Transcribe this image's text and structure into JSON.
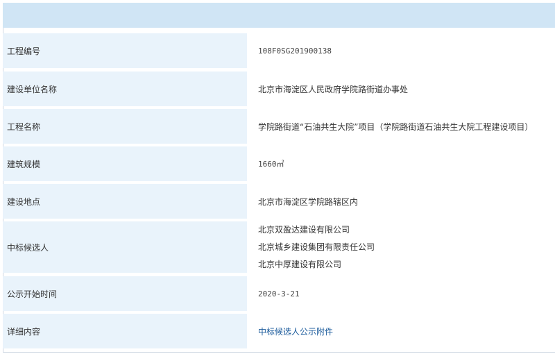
{
  "colors": {
    "header": "#d0e5f5",
    "label_bg": "#e9f3fb",
    "link": "#1a5a9b"
  },
  "rows": {
    "project_number": {
      "label": "工程编号",
      "value": "108F0SG201900138"
    },
    "builder": {
      "label": "建设单位名称",
      "value": "北京市海淀区人民政府学院路街道办事处"
    },
    "project_name": {
      "label": "工程名称",
      "value": "学院路街道“石油共生大院”项目（学院路街道石油共生大院工程建设项目）"
    },
    "scale": {
      "label": "建筑规模",
      "value": "1660㎡"
    },
    "location": {
      "label": "建设地点",
      "value": "北京市海淀区学院路辖区内"
    },
    "candidates": {
      "label": "中标候选人",
      "values": [
        "北京双盈达建设有限公司",
        "北京城乡建设集团有限责任公司",
        "北京中厚建设有限公司"
      ]
    },
    "start_date": {
      "label": "公示开始时间",
      "value": "2020-3-21"
    },
    "details": {
      "label": "详细内容",
      "link_text": "中标候选人公示附件"
    }
  }
}
